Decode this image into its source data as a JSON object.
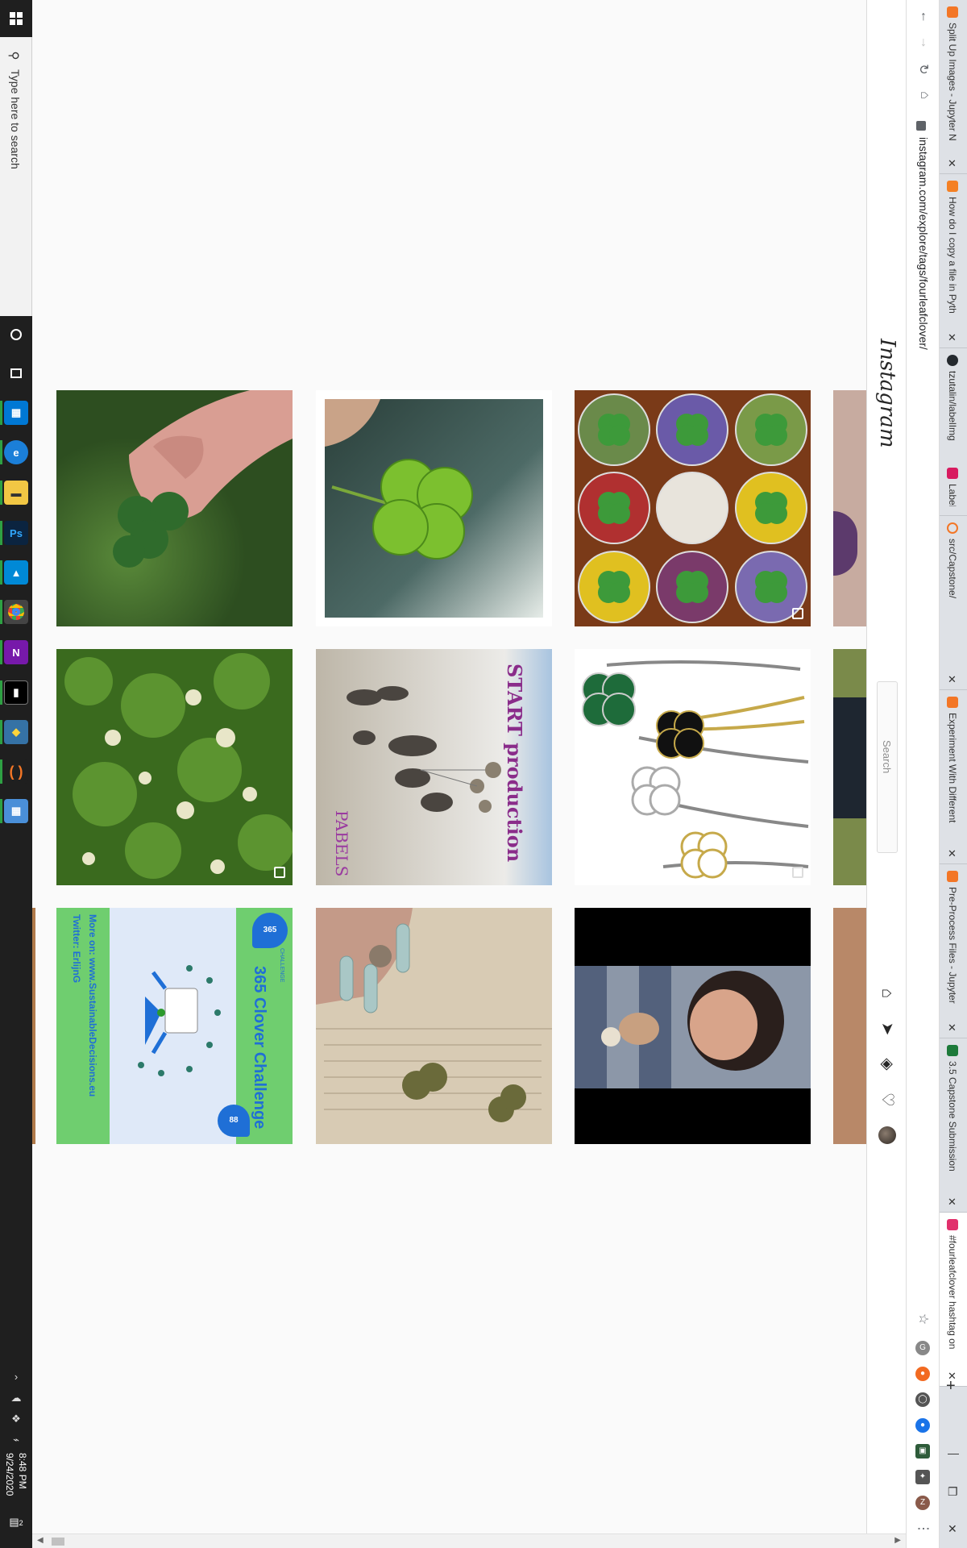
{
  "taskbar": {
    "search_placeholder": "Type here to search",
    "clock_time": "8:48 PM",
    "clock_date": "9/24/2020",
    "notification_count": "2",
    "apps": [
      "task-view",
      "store",
      "edge",
      "file-explorer",
      "photoshop",
      "azure",
      "chrome",
      "onenote",
      "terminal",
      "python",
      "jupyter",
      "calculator"
    ]
  },
  "browser": {
    "url": "instagram.com/explore/tags/fourleafclover/",
    "tabs": [
      {
        "label": "Split Up Images - Jupyter N",
        "color": "#f37626"
      },
      {
        "label": "How do I copy a file in Pyth",
        "color": "#f48024"
      },
      {
        "label": "tzutalin/labelImg",
        "color": "#24292e"
      },
      {
        "label": "Label",
        "color": "#d81b60"
      },
      {
        "label": "src/Capstone/",
        "color": "#f37626"
      },
      {
        "label": "Experiment With Different",
        "color": "#f37626"
      },
      {
        "label": "Pre-Process Files - Jupyter",
        "color": "#f37626"
      },
      {
        "label": "3.5 Capstone Submission",
        "color": "#1d7a3a"
      },
      {
        "label": "#fourleafclover hashtag on",
        "color": "#e1306c"
      }
    ],
    "new_tab": "+",
    "window_controls": {
      "minimize": "—",
      "restore": "❐",
      "close": "✕"
    }
  },
  "instagram": {
    "logo": "Instagram",
    "search_placeholder": "Search",
    "nav_icons": [
      "home-icon",
      "direct-icon",
      "explore-icon",
      "activity-icon",
      "profile-avatar"
    ]
  },
  "tiles": [
    {
      "name": "post-hand-clover",
      "alt": "hand holding four leaf clover",
      "multi": false
    },
    {
      "name": "post-bright-clover",
      "alt": "four leaf clover closeup",
      "multi": false
    },
    {
      "name": "post-resin-clovers",
      "alt": "resin paperweights with clovers",
      "multi": true
    },
    {
      "name": "post-clover-field",
      "alt": "white clover flowers",
      "multi": true
    },
    {
      "name": "post-pebble-art",
      "alt": "pebble art family",
      "multi": false,
      "overlay_text": "START production",
      "overlay_text_2": "PABELS"
    },
    {
      "name": "post-clover-necklaces",
      "alt": "clover necklaces",
      "multi": true
    },
    {
      "name": "post-365-challenge",
      "alt": "365 clover challenge",
      "title": "365 Clover Challenge",
      "badge_top": "365",
      "badge_sub": "CHALLENGE",
      "badge_bottom": "88",
      "footer_line1": "More on: www.SustainableDecisions.eu",
      "footer_line2": "Twitter: ErlijnG"
    },
    {
      "name": "post-nails-book-clover",
      "alt": "pressed clovers in a book",
      "multi": false
    },
    {
      "name": "post-woman-portrait",
      "alt": "woman portrait",
      "multi": false
    }
  ],
  "colors": {
    "ig_bg": "#fafafa",
    "taskbar": "#1f1f1f",
    "green_365": "#6fce6f",
    "blue_365": "#1f6fd6"
  }
}
